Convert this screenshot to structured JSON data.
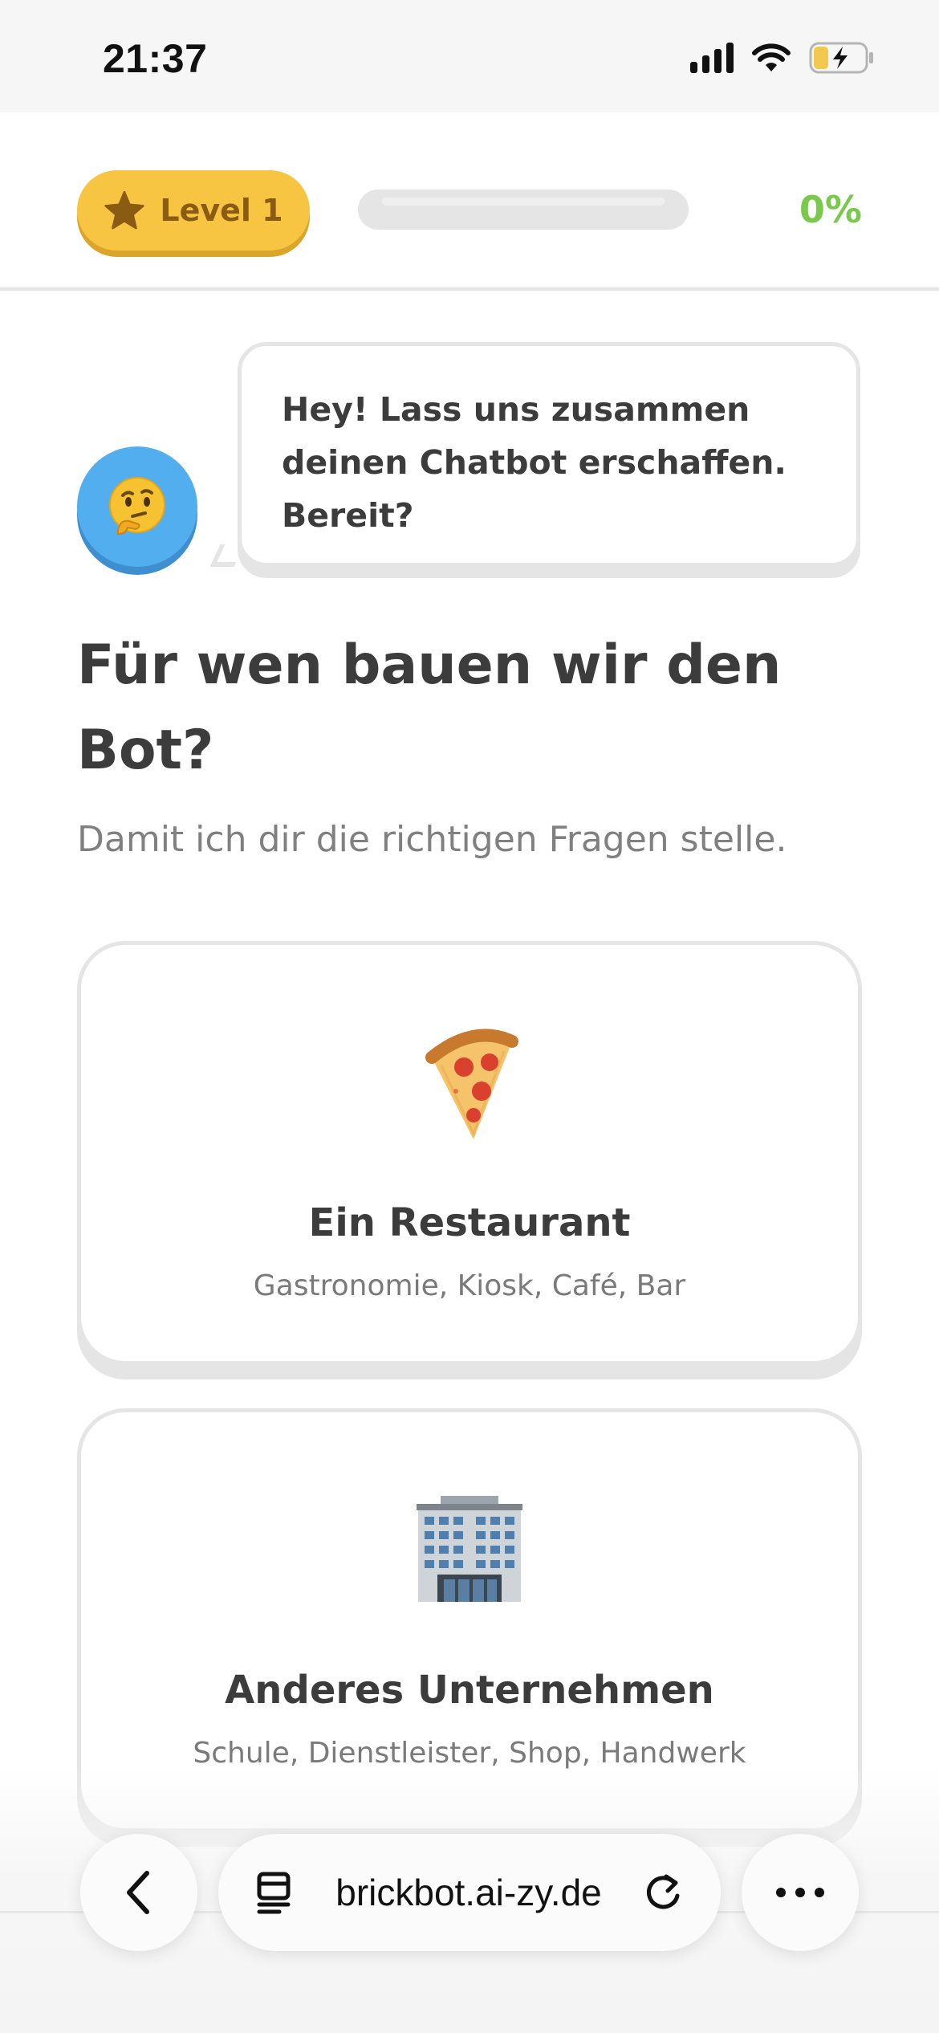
{
  "status_bar": {
    "time": "21:37"
  },
  "header": {
    "level_label": "Level 1",
    "progress_percent_label": "0%",
    "progress_value": 0,
    "accent_color": "#7ac94c",
    "level_color": "#f7c542"
  },
  "bot": {
    "avatar_emoji": "🤔",
    "message": "Hey! Lass uns zusammen deinen Chatbot erschaffen. Bereit?"
  },
  "question": {
    "title": "Für wen bauen wir den Bot?",
    "subtitle": "Damit ich dir die richtigen Fragen stelle."
  },
  "options": [
    {
      "icon": "pizza-icon",
      "title": "Ein Restaurant",
      "description": "Gastronomie, Kiosk, Café, Bar"
    },
    {
      "icon": "office-building-icon",
      "title": "Anderes Unternehmen",
      "description": "Schule, Dienstleister, Shop, Handwerk"
    }
  ],
  "browser": {
    "url": "brickbot.ai-zy.de"
  }
}
